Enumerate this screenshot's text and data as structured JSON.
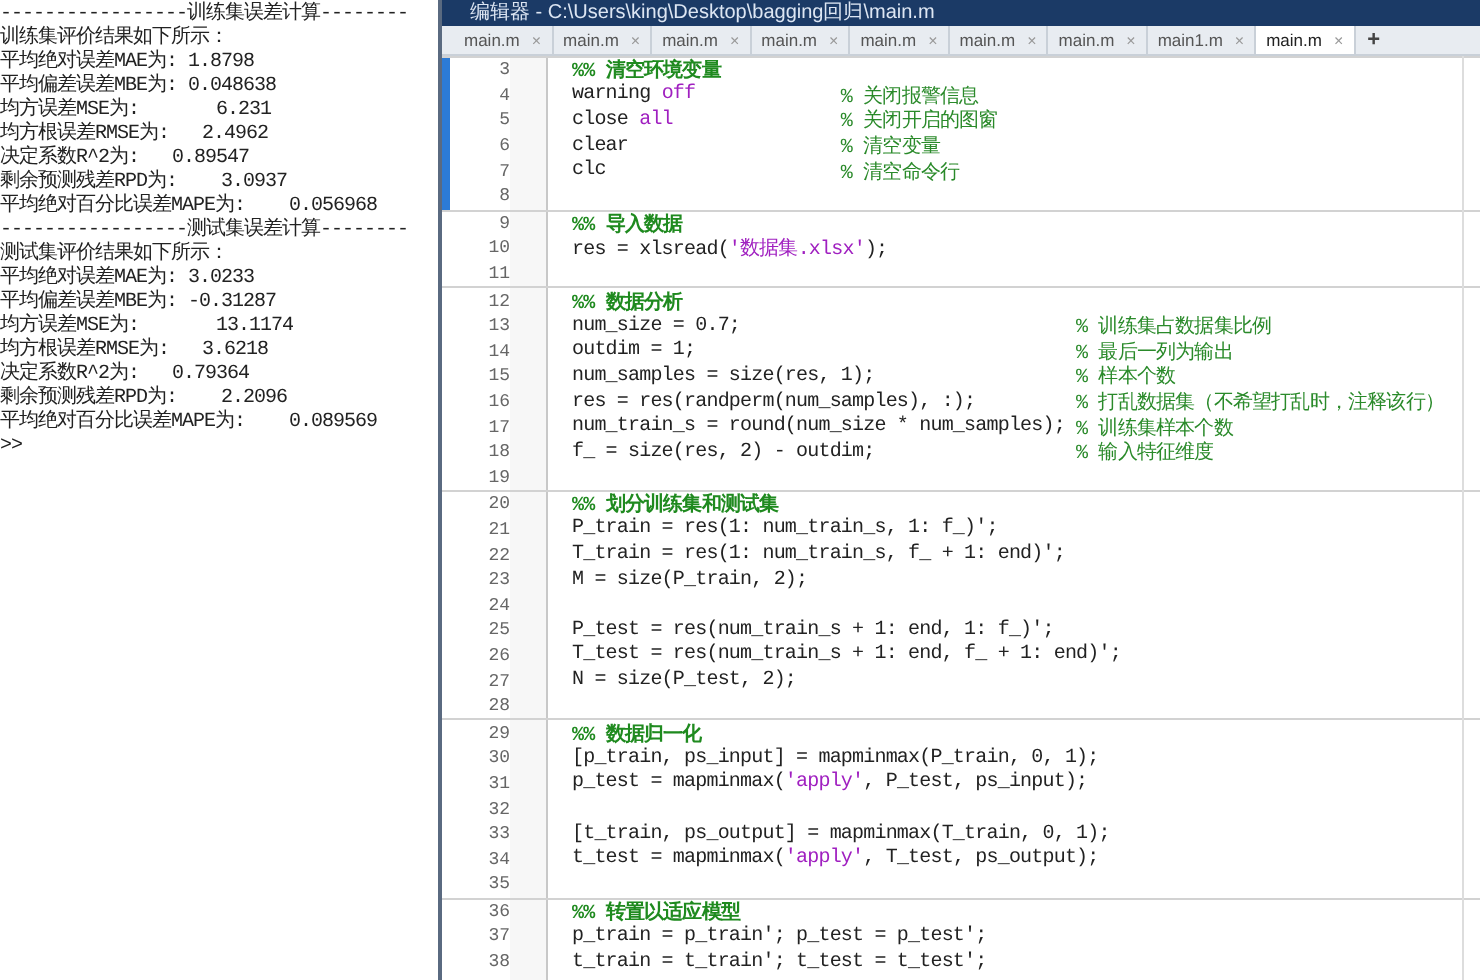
{
  "console": {
    "lines": [
      "-----------------训练集误差计算--------",
      "训练集评价结果如下所示：",
      "平均绝对误差MAE为: 1.8798",
      "平均偏差误差MBE为: 0.048638",
      "均方误差MSE为:       6.231",
      "均方根误差RMSE为:   2.4962",
      "决定系数R^2为:   0.89547",
      "剩余预测残差RPD为:    3.0937",
      "平均绝对百分比误差MAPE为:    0.056968",
      "-----------------测试集误差计算--------",
      "测试集评价结果如下所示：",
      "平均绝对误差MAE为: 3.0233",
      "平均偏差误差MBE为: -0.31287",
      "均方误差MSE为:       13.1174",
      "均方根误差RMSE为:   3.6218",
      "决定系数R^2为:   0.79364",
      "剩余预测残差RPD为:    2.2096",
      "平均绝对百分比误差MAPE为:    0.089569",
      ">>"
    ]
  },
  "editor": {
    "title": "编辑器 - C:\\Users\\king\\Desktop\\bagging回归\\main.m",
    "tabs": [
      {
        "label": "main.m",
        "close": "×",
        "selected": false
      },
      {
        "label": "main.m",
        "close": "×",
        "selected": false
      },
      {
        "label": "main.m",
        "close": "×",
        "selected": false
      },
      {
        "label": "main.m",
        "close": "×",
        "selected": false
      },
      {
        "label": "main.m",
        "close": "×",
        "selected": false
      },
      {
        "label": "main.m",
        "close": "×",
        "selected": false
      },
      {
        "label": "main.m",
        "close": "×",
        "selected": false
      },
      {
        "label": "main1.m",
        "close": "×",
        "selected": false
      },
      {
        "label": "main.m",
        "close": "×",
        "selected": true
      }
    ],
    "new_tab": "+",
    "sections": [
      {
        "current": true,
        "lines": [
          {
            "number": "3",
            "code": [
              {
                "kind": "heading",
                "text": "%% 清空环境变量"
              }
            ]
          },
          {
            "number": "4",
            "code": [
              {
                "kind": "plain",
                "text": "warning "
              },
              {
                "kind": "keyword",
                "text": "off"
              }
            ],
            "comment": "% 关闭报警信息"
          },
          {
            "number": "5",
            "code": [
              {
                "kind": "plain",
                "text": "close "
              },
              {
                "kind": "keyword",
                "text": "all"
              }
            ],
            "comment": "% 关闭开启的图窗"
          },
          {
            "number": "6",
            "code": [
              {
                "kind": "plain",
                "text": "clear"
              }
            ],
            "comment": "% 清空变量"
          },
          {
            "number": "7",
            "code": [
              {
                "kind": "plain",
                "text": "clc"
              }
            ],
            "comment": "% 清空命令行"
          },
          {
            "number": "8"
          }
        ]
      },
      {
        "current": false,
        "lines": [
          {
            "number": "9",
            "code": [
              {
                "kind": "heading",
                "text": "%% 导入数据"
              }
            ]
          },
          {
            "number": "10",
            "code": [
              {
                "kind": "plain",
                "text": "res = xlsread("
              },
              {
                "kind": "string",
                "text": "'数据集.xlsx'"
              },
              {
                "kind": "plain",
                "text": ");"
              }
            ]
          },
          {
            "number": "11"
          }
        ]
      },
      {
        "current": false,
        "lines": [
          {
            "number": "12",
            "code": [
              {
                "kind": "heading",
                "text": "%% 数据分析"
              }
            ]
          },
          {
            "number": "13",
            "code": [
              {
                "kind": "plain",
                "text": "num_size = 0.7;"
              }
            ],
            "comment": "% 训练集占数据集比例"
          },
          {
            "number": "14",
            "code": [
              {
                "kind": "plain",
                "text": "outdim = 1;"
              }
            ],
            "comment": "% 最后一列为输出"
          },
          {
            "number": "15",
            "code": [
              {
                "kind": "plain",
                "text": "num_samples = size(res, 1);"
              }
            ],
            "comment": "% 样本个数"
          },
          {
            "number": "16",
            "code": [
              {
                "kind": "plain",
                "text": "res = res(randperm(num_samples), :);"
              }
            ],
            "comment": "% 打乱数据集（不希望打乱时，注释该行）"
          },
          {
            "number": "17",
            "code": [
              {
                "kind": "plain",
                "text": "num_train_s = round(num_size * num_samples);"
              }
            ],
            "comment": "% 训练集样本个数"
          },
          {
            "number": "18",
            "code": [
              {
                "kind": "plain",
                "text": "f_ = size(res, 2) - outdim;"
              }
            ],
            "comment": "% 输入特征维度"
          },
          {
            "number": "19"
          }
        ]
      },
      {
        "current": false,
        "lines": [
          {
            "number": "20",
            "code": [
              {
                "kind": "heading",
                "text": "%% 划分训练集和测试集"
              }
            ]
          },
          {
            "number": "21",
            "code": [
              {
                "kind": "plain",
                "text": "P_train = res(1: num_train_s, 1: f_)';"
              }
            ]
          },
          {
            "number": "22",
            "code": [
              {
                "kind": "plain",
                "text": "T_train = res(1: num_train_s, f_ + 1: end)';"
              }
            ]
          },
          {
            "number": "23",
            "code": [
              {
                "kind": "plain",
                "text": "M = size(P_train, 2);"
              }
            ]
          },
          {
            "number": "24"
          },
          {
            "number": "25",
            "code": [
              {
                "kind": "plain",
                "text": "P_test = res(num_train_s + 1: end, 1: f_)';"
              }
            ]
          },
          {
            "number": "26",
            "code": [
              {
                "kind": "plain",
                "text": "T_test = res(num_train_s + 1: end, f_ + 1: end)';"
              }
            ]
          },
          {
            "number": "27",
            "code": [
              {
                "kind": "plain",
                "text": "N = size(P_test, 2);"
              }
            ]
          },
          {
            "number": "28"
          }
        ]
      },
      {
        "current": false,
        "lines": [
          {
            "number": "29",
            "code": [
              {
                "kind": "heading",
                "text": "%% 数据归一化"
              }
            ]
          },
          {
            "number": "30",
            "code": [
              {
                "kind": "plain",
                "text": "[p_train, ps_input] = mapminmax(P_train, 0, 1);"
              }
            ]
          },
          {
            "number": "31",
            "code": [
              {
                "kind": "plain",
                "text": "p_test = mapminmax("
              },
              {
                "kind": "string",
                "text": "'apply'"
              },
              {
                "kind": "plain",
                "text": ", P_test, ps_input);"
              }
            ]
          },
          {
            "number": "32"
          },
          {
            "number": "33",
            "code": [
              {
                "kind": "plain",
                "text": "[t_train, ps_output] = mapminmax(T_train, 0, 1);"
              }
            ]
          },
          {
            "number": "34",
            "code": [
              {
                "kind": "plain",
                "text": "t_test = mapminmax("
              },
              {
                "kind": "string",
                "text": "'apply'"
              },
              {
                "kind": "plain",
                "text": ", T_test, ps_output);"
              }
            ]
          },
          {
            "number": "35"
          }
        ]
      },
      {
        "current": false,
        "lines": [
          {
            "number": "36",
            "code": [
              {
                "kind": "heading",
                "text": "%% 转置以适应模型"
              }
            ]
          },
          {
            "number": "37",
            "code": [
              {
                "kind": "plain",
                "text": "p_train = p_train'; p_test = p_test';"
              }
            ]
          },
          {
            "number": "38",
            "code": [
              {
                "kind": "plain",
                "text": "t_train = t_train'; t_test = t_test';"
              }
            ]
          }
        ]
      }
    ]
  }
}
